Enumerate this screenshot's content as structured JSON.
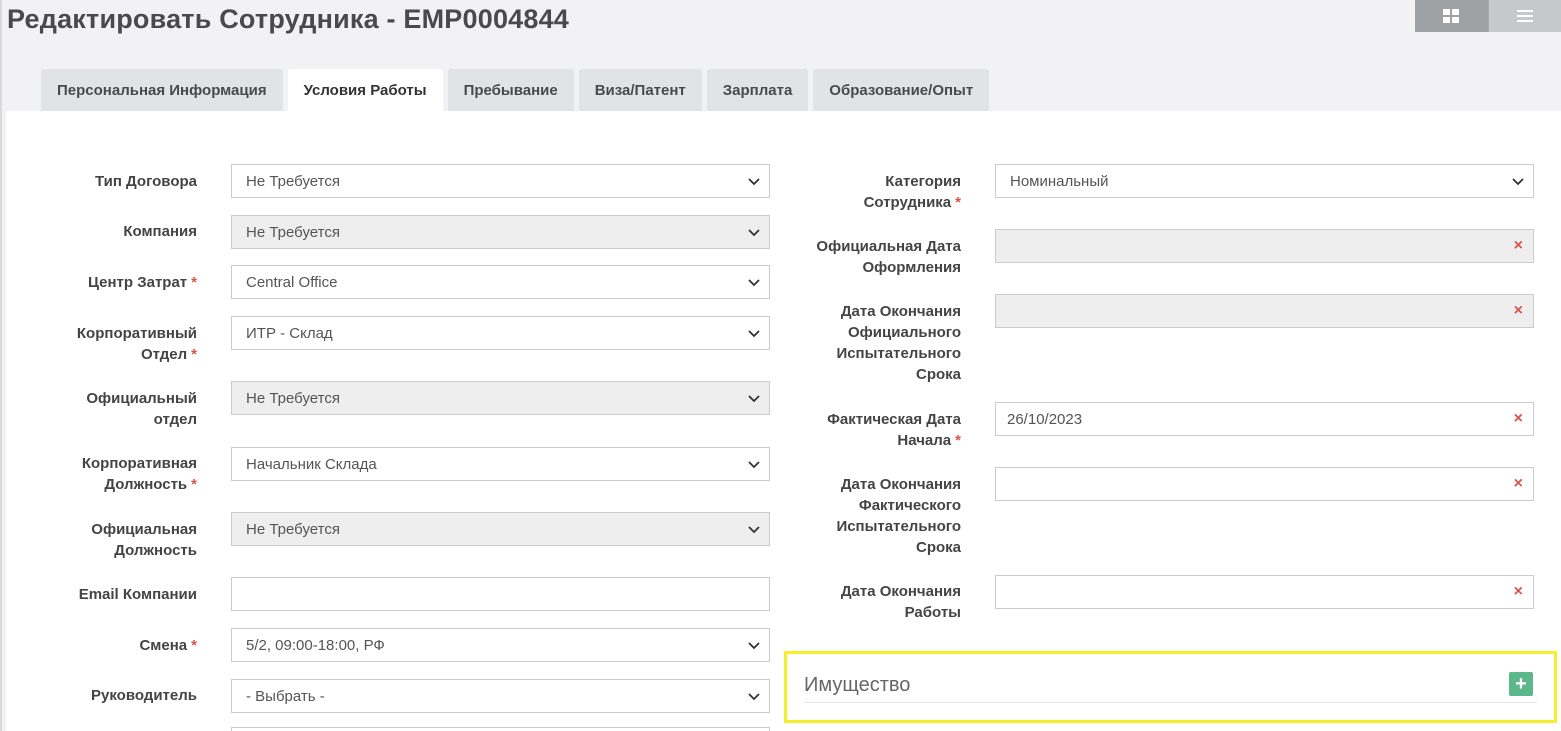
{
  "header": {
    "title": "Редактировать Сотрудника - EMP0004844"
  },
  "view_toggle": {
    "grid_icon": "grid-icon",
    "list_icon": "list-icon"
  },
  "tabs": [
    {
      "label": "Персональная Информация"
    },
    {
      "label": "Условия Работы",
      "active": true
    },
    {
      "label": "Пребывание"
    },
    {
      "label": "Виза/Патент"
    },
    {
      "label": "Зарплата"
    },
    {
      "label": "Образование/Опыт"
    }
  ],
  "left_form": {
    "contract_type": {
      "label": "Тип Договора",
      "value": "Не Требуется"
    },
    "company": {
      "label": "Компания",
      "value": "Не Требуется"
    },
    "cost_center": {
      "label": "Центр Затрат",
      "value": "Central Office"
    },
    "corp_department": {
      "label_1": "Корпоративный",
      "label_2": "Отдел",
      "value": "ИТР - Склад"
    },
    "official_department": {
      "label_1": "Официальный",
      "label_2": "отдел",
      "value": "Не Требуется"
    },
    "corp_position": {
      "label_1": "Корпоративная",
      "label_2": "Должность",
      "value": "Начальник Склада"
    },
    "official_position": {
      "label_1": "Официальная",
      "label_2": "Должность",
      "value": "Не Требуется"
    },
    "company_email": {
      "label": "Email Компании",
      "value": ""
    },
    "shift": {
      "label": "Смена",
      "value": "5/2, 09:00-18:00, РФ"
    },
    "manager": {
      "label": "Руководитель",
      "value": "- Выбрать -"
    }
  },
  "right_form": {
    "employee_category": {
      "label_1": "Категория",
      "label_2": "Сотрудника",
      "value": "Номинальный"
    },
    "official_hire_date": {
      "label_1": "Официальная Дата",
      "label_2": "Оформления",
      "value": ""
    },
    "official_probation_end": {
      "label_1": "Дата Окончания",
      "label_2": "Официального",
      "label_3": "Испытательного",
      "label_4": "Срока",
      "value": ""
    },
    "actual_start_date": {
      "label_1": "Фактическая Дата",
      "label_2": "Начала",
      "value": "26/10/2023"
    },
    "actual_probation_end": {
      "label_1": "Дата Окончания",
      "label_2": "Фактического",
      "label_3": "Испытательного",
      "label_4": "Срока",
      "value": ""
    },
    "employment_end": {
      "label_1": "Дата Окончания",
      "label_2": "Работы",
      "value": ""
    }
  },
  "required_mark": "*",
  "clear_mark": "×",
  "assets": {
    "title": "Имущество",
    "add_label": "+"
  },
  "colors": {
    "required": "#d9534f",
    "highlight": "#f5ee2a",
    "add_button": "#5cb88a"
  }
}
